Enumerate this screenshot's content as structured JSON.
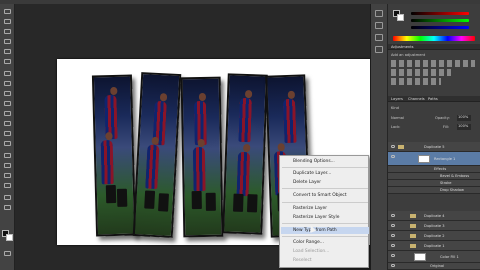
{
  "context_menu": {
    "items": [
      {
        "label": "Blending Options...",
        "disabled": false
      },
      {
        "label": "Duplicate Layer...",
        "disabled": false
      },
      {
        "label": "Delete Layer",
        "disabled": false
      },
      {
        "label": "Convert to Smart Object",
        "disabled": false
      },
      {
        "label": "Rasterize Layer",
        "disabled": false
      },
      {
        "label": "Rasterize Layer Style",
        "disabled": false
      },
      {
        "label": "New Type from Path",
        "disabled": false,
        "highlighted": true
      },
      {
        "label": "Color Range...",
        "disabled": false
      },
      {
        "label": "Load Selection...",
        "disabled": true
      },
      {
        "label": "Reselect",
        "disabled": true
      }
    ]
  },
  "panels": {
    "adjustments_tab": "Adjustments",
    "add_adjustment": "Add an adjustment",
    "layers_tabs": [
      "Layers",
      "Channels",
      "Paths"
    ],
    "kind_label": "Kind",
    "opacity_label": "Opacity:",
    "opacity_value": "100%",
    "lock_label": "Lock:",
    "fill_label": "Fill:",
    "fill_value": "100%",
    "layers": [
      {
        "name": "Duplicate 5",
        "type": "group"
      },
      {
        "name": "Rectangle 1",
        "type": "shape",
        "selected": true
      },
      {
        "name": "Effects",
        "type": "effects"
      },
      {
        "name": "Bevel & Emboss",
        "type": "effect"
      },
      {
        "name": "Stroke",
        "type": "effect"
      },
      {
        "name": "Drop Shadow",
        "type": "effect"
      },
      {
        "name": "Duplicate 4",
        "type": "group"
      },
      {
        "name": "Duplicate 3",
        "type": "group"
      },
      {
        "name": "Duplicate 2",
        "type": "group"
      },
      {
        "name": "Duplicate 1",
        "type": "group"
      },
      {
        "name": "Color Fill 1",
        "type": "fill"
      },
      {
        "name": "Original",
        "type": "layer"
      }
    ]
  },
  "colors": {
    "accent": "#5b7ca6",
    "menu_bg": "#eeeeee",
    "kit_blue": "#10246e",
    "kit_red": "#8a1428"
  }
}
